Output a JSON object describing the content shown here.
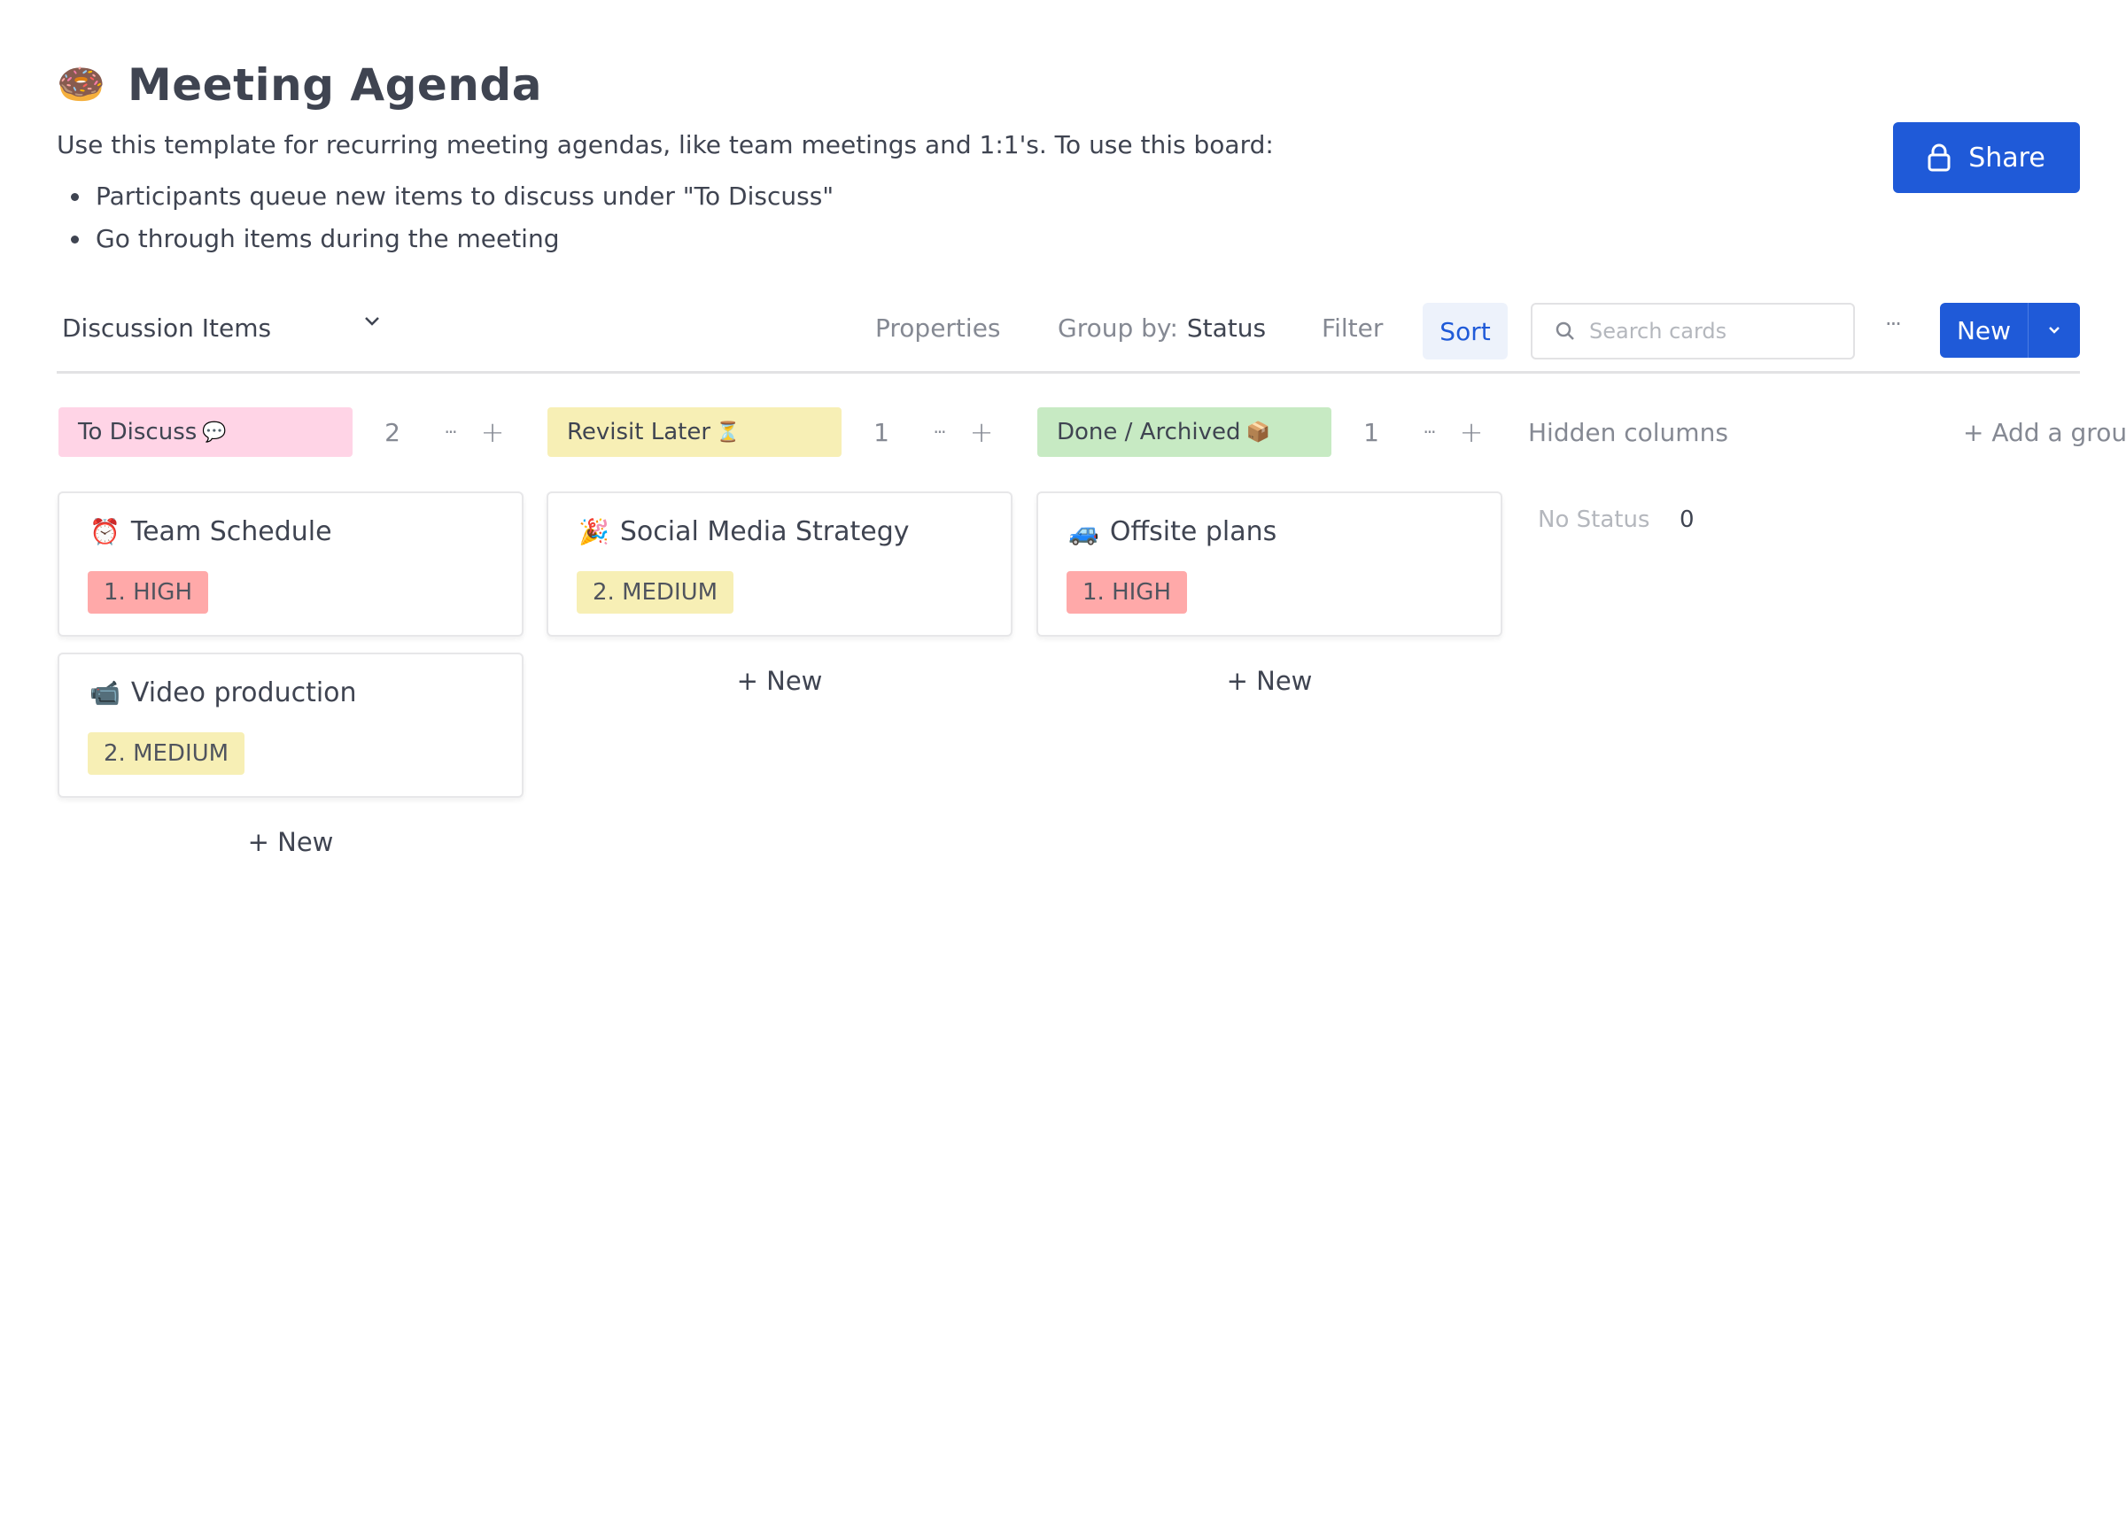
{
  "header": {
    "icon": "🍩",
    "title": "Meeting Agenda",
    "description": "Use this template for recurring meeting agendas, like team meetings and 1:1's. To use this board:",
    "bullets": [
      "Participants queue new items to discuss under \"To Discuss\"",
      "Go through items during the meeting"
    ],
    "share_label": "Share"
  },
  "toolbar": {
    "view_name": "Discussion Items",
    "properties_label": "Properties",
    "group_by_label": "Group by:",
    "group_by_value": "Status",
    "filter_label": "Filter",
    "sort_label": "Sort",
    "search_placeholder": "Search cards",
    "more_label": "···",
    "new_label": "New"
  },
  "columns": [
    {
      "name": "To Discuss",
      "emoji": "💬",
      "count": "2",
      "color": "#ffd4e6",
      "cards": [
        {
          "emoji": "⏰",
          "title": "Team Schedule",
          "priority": "1. HIGH",
          "priority_level": "high"
        },
        {
          "emoji": "📹",
          "title": "Video production",
          "priority": "2. MEDIUM",
          "priority_level": "medium"
        }
      ],
      "add_label": "+ New"
    },
    {
      "name": "Revisit Later",
      "emoji": "⏳",
      "count": "1",
      "color": "#f7efb5",
      "cards": [
        {
          "emoji": "🎉",
          "title": "Social Media Strategy",
          "priority": "2. MEDIUM",
          "priority_level": "medium"
        }
      ],
      "add_label": "+ New"
    },
    {
      "name": "Done / Archived",
      "emoji": "📦",
      "count": "1",
      "color": "#c7eac3",
      "cards": [
        {
          "emoji": "🚙",
          "title": "Offsite plans",
          "priority": "1. HIGH",
          "priority_level": "high"
        }
      ],
      "add_label": "+ New"
    }
  ],
  "hidden_columns": {
    "label": "Hidden columns",
    "items": [
      {
        "name": "No Status",
        "count": "0"
      }
    ]
  },
  "add_group_label": "+ Add a group",
  "colors": {
    "accent": "#1f5ad8",
    "high": "#ffa9a9",
    "medium": "#f7efb5"
  }
}
